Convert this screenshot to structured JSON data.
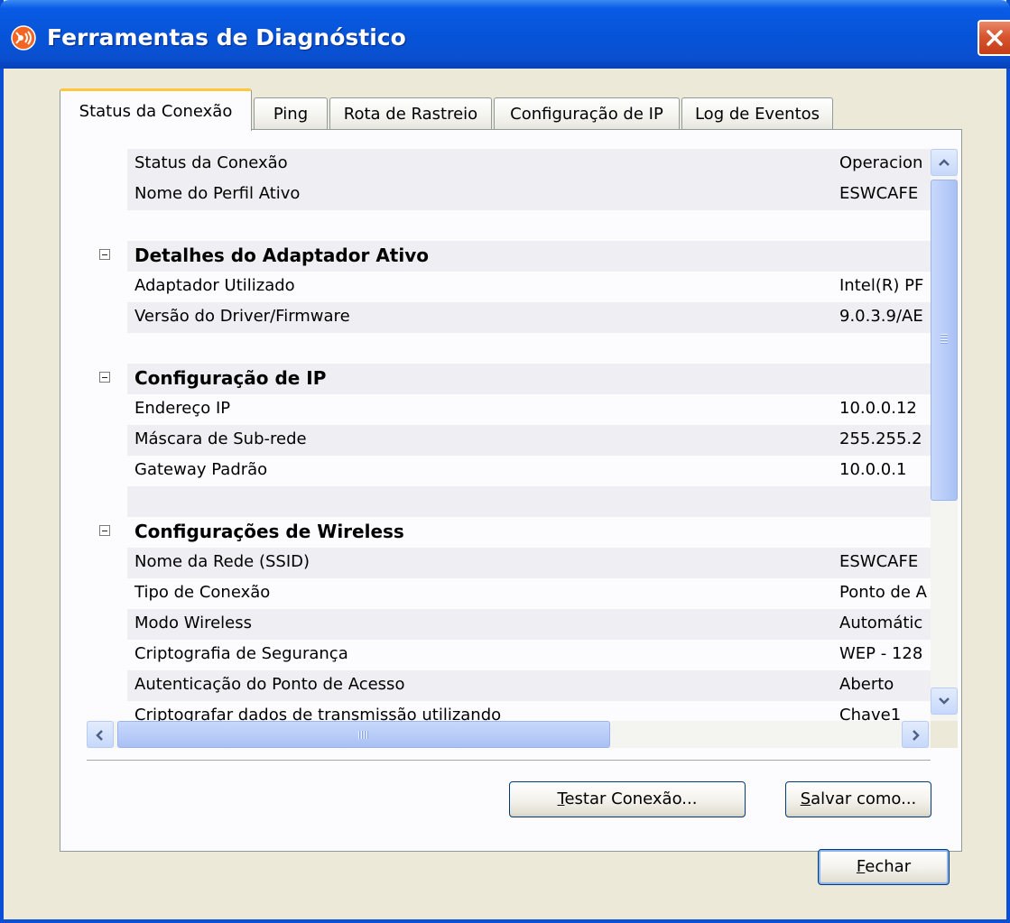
{
  "window": {
    "title": "Ferramentas de Diagnóstico",
    "close_label": "×"
  },
  "tabs": [
    {
      "label": "Status da Conexão",
      "active": true
    },
    {
      "label": "Ping",
      "active": false
    },
    {
      "label": "Rota de Rastreio",
      "active": false
    },
    {
      "label": "Configuração de IP",
      "active": false
    },
    {
      "label": "Log de Eventos",
      "active": false
    }
  ],
  "rows": [
    {
      "type": "item",
      "label": "Status da Conexão",
      "value": "Operacion"
    },
    {
      "type": "item",
      "label": "Nome do Perfil Ativo",
      "value": "ESWCAFE"
    },
    {
      "type": "blank"
    },
    {
      "type": "section",
      "label": "Detalhes do Adaptador Ativo"
    },
    {
      "type": "item",
      "label": "Adaptador Utilizado",
      "value": "Intel(R) PF"
    },
    {
      "type": "item",
      "label": "Versão do Driver/Firmware",
      "value": "9.0.3.9/AE"
    },
    {
      "type": "blank"
    },
    {
      "type": "section",
      "label": "Configuração de IP"
    },
    {
      "type": "item",
      "label": "Endereço IP",
      "value": "10.0.0.12"
    },
    {
      "type": "item",
      "label": "Máscara de Sub-rede",
      "value": "255.255.2"
    },
    {
      "type": "item",
      "label": "Gateway Padrão",
      "value": "10.0.0.1"
    },
    {
      "type": "blank"
    },
    {
      "type": "section",
      "label": "Configurações de Wireless"
    },
    {
      "type": "item",
      "label": "Nome da Rede (SSID)",
      "value": "ESWCAFE"
    },
    {
      "type": "item",
      "label": "Tipo de Conexão",
      "value": "Ponto de A"
    },
    {
      "type": "item",
      "label": "Modo Wireless",
      "value": "Automátic"
    },
    {
      "type": "item",
      "label": "Criptografia de Segurança",
      "value": "WEP - 128"
    },
    {
      "type": "item",
      "label": "Autenticação do Ponto de Acesso",
      "value": "Aberto"
    },
    {
      "type": "item",
      "label": "Criptografar dados de transmissão utilizando",
      "value": "Chave1"
    }
  ],
  "buttons": {
    "test_prefix": "",
    "test_mnemonic": "T",
    "test_rest": "estar Conexão...",
    "save_mnemonic": "S",
    "save_rest": "alvar como...",
    "close_mnemonic": "F",
    "close_rest": "echar"
  },
  "icons": {
    "app": "diagnostic-app-icon",
    "close": "close-icon",
    "scroll_up": "scroll-up-arrow-icon",
    "scroll_down": "scroll-down-arrow-icon",
    "scroll_left": "scroll-left-arrow-icon",
    "scroll_right": "scroll-right-arrow-icon",
    "expander": "collapse-minus-icon"
  },
  "colors": {
    "titlebar": "#0654d8",
    "active_tab_accent": "#ffc83c",
    "row_band": "#efeef3"
  }
}
